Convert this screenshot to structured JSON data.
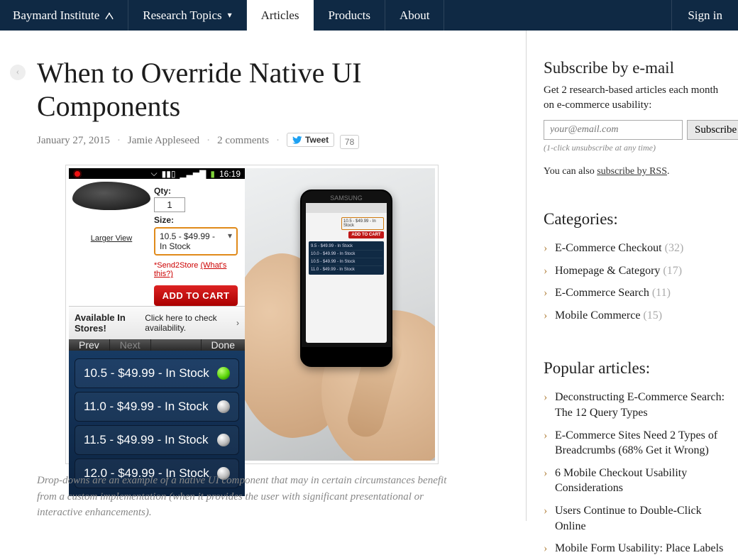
{
  "nav": {
    "logo": "Baymard Institute",
    "items": [
      {
        "label": "Research Topics",
        "hasDropdown": true,
        "active": false
      },
      {
        "label": "Articles",
        "hasDropdown": false,
        "active": true
      },
      {
        "label": "Products",
        "hasDropdown": false,
        "active": false
      },
      {
        "label": "About",
        "hasDropdown": false,
        "active": false
      }
    ],
    "signin": "Sign in"
  },
  "article": {
    "title": "When to Override Native UI Components",
    "date": "January 27, 2015",
    "author": "Jamie Appleseed",
    "comments": "2 comments",
    "tweet_label": "Tweet",
    "tweet_count": "78",
    "caption": "Drop-downs are an example of a native UI component that may in certain circumstances benefit from a custom implementation (when it provides the user with significant presentational or interactive enhancements)."
  },
  "figure_phone": {
    "time": "16:19",
    "qty_label": "Qty:",
    "qty_value": "1",
    "size_label": "Size:",
    "size_value": "10.5 - $49.99 - In Stock",
    "larger_view": "Larger View",
    "send2store": "*Send2Store ",
    "send2store_link": "(What's this?)",
    "add_to_cart": "ADD TO CART",
    "instores_bold": "Available In Stores!",
    "instores_rest": " Click here to check availability.",
    "prev": "Prev",
    "next": "Next",
    "done": "Done",
    "options": [
      {
        "label": "10.5 - $49.99 - In Stock",
        "selected": true
      },
      {
        "label": "11.0 - $49.99 - In Stock",
        "selected": false
      },
      {
        "label": "11.5 - $49.99 - In Stock",
        "selected": false
      },
      {
        "label": "12.0 - $49.99 - In Stock",
        "selected": false
      }
    ],
    "device_brand": "SAMSUNG",
    "mini_rows": [
      "9.5 - $49.99 - In Stock",
      "10.0 - $49.99 - In Stock",
      "10.5 - $49.99 - In Stock",
      "11.0 - $49.99 - In Stock"
    ]
  },
  "sidebar": {
    "subscribe_heading": "Subscribe by e-mail",
    "subscribe_desc": "Get 2 research-based articles each month on e-commerce usability:",
    "email_placeholder": "your@email.com",
    "subscribe_btn": "Subscribe",
    "unsub_note": "(1-click unsubscribe at any time)",
    "rss_pre": "You can also ",
    "rss_link": "subscribe by RSS",
    "categories_heading": "Categories:",
    "categories": [
      {
        "label": "E-Commerce Checkout",
        "count": "(32)"
      },
      {
        "label": "Homepage & Category",
        "count": "(17)"
      },
      {
        "label": "E-Commerce Search",
        "count": "(11)"
      },
      {
        "label": "Mobile Commerce",
        "count": "(15)"
      }
    ],
    "popular_heading": "Popular articles:",
    "popular": [
      "Deconstructing E-Commerce Search: The 12 Query Types",
      "E-Commerce Sites Need 2 Types of Breadcrumbs (68% Get it Wrong)",
      "6 Mobile Checkout Usability Considerations",
      "Users Continue to Double-Click Online",
      "Mobile Form Usability: Place Labels"
    ]
  }
}
